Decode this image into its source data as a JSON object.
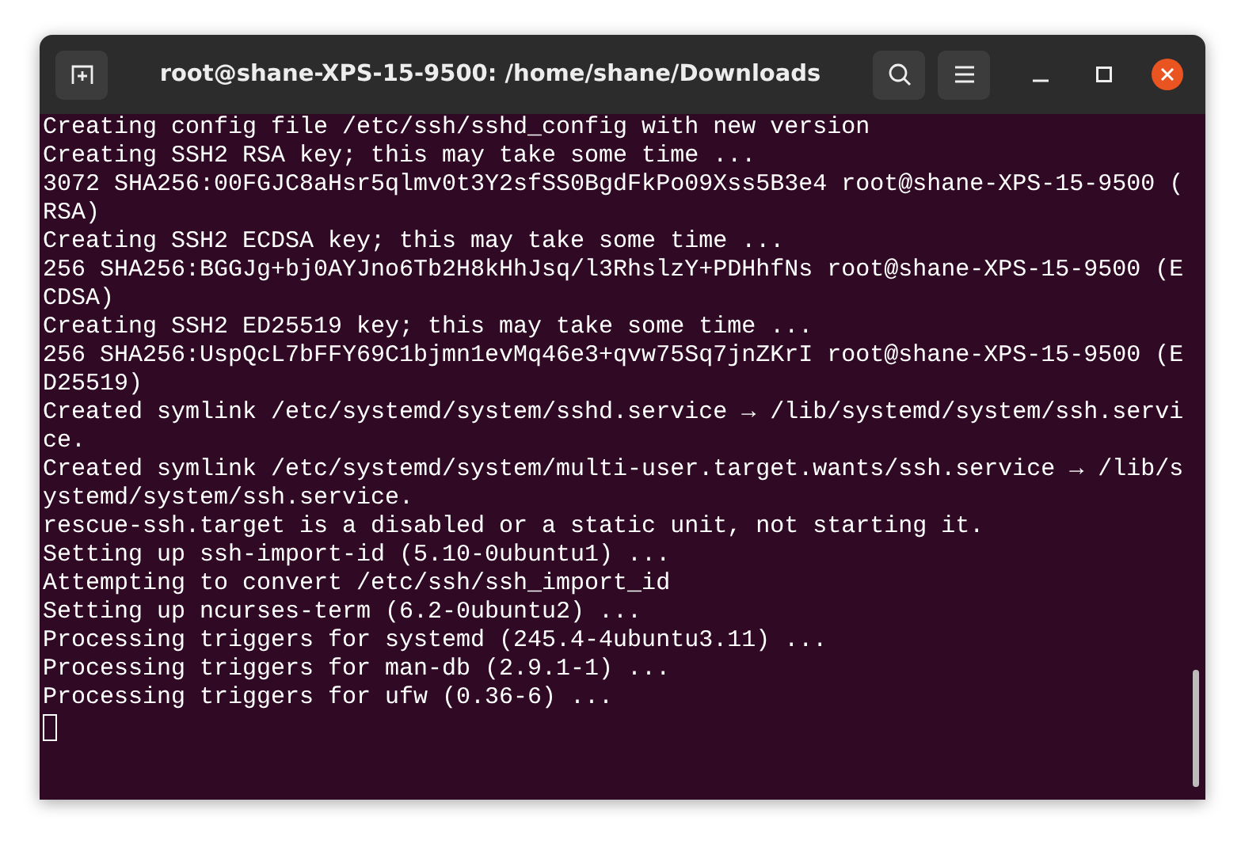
{
  "window": {
    "title": "root@shane-XPS-15-9500: /home/shane/Downloads"
  },
  "terminal": {
    "lines": [
      "Creating config file /etc/ssh/sshd_config with new version",
      "Creating SSH2 RSA key; this may take some time ...",
      "3072 SHA256:00FGJC8aHsr5qlmv0t3Y2sfSS0BgdFkPo09Xss5B3e4 root@shane-XPS-15-9500 (",
      "RSA)",
      "Creating SSH2 ECDSA key; this may take some time ...",
      "256 SHA256:BGGJg+bj0AYJno6Tb2H8kHhJsq/l3RhslzY+PDHhfNs root@shane-XPS-15-9500 (E",
      "CDSA)",
      "Creating SSH2 ED25519 key; this may take some time ...",
      "256 SHA256:UspQcL7bFFY69C1bjmn1evMq46e3+qvw75Sq7jnZKrI root@shane-XPS-15-9500 (E",
      "D25519)",
      "Created symlink /etc/systemd/system/sshd.service → /lib/systemd/system/ssh.servi",
      "ce.",
      "Created symlink /etc/systemd/system/multi-user.target.wants/ssh.service → /lib/s",
      "ystemd/system/ssh.service.",
      "rescue-ssh.target is a disabled or a static unit, not starting it.",
      "Setting up ssh-import-id (5.10-0ubuntu1) ...",
      "Attempting to convert /etc/ssh/ssh_import_id",
      "Setting up ncurses-term (6.2-0ubuntu2) ...",
      "Processing triggers for systemd (245.4-4ubuntu3.11) ...",
      "Processing triggers for man-db (2.9.1-1) ...",
      "Processing triggers for ufw (0.36-6) ..."
    ]
  }
}
